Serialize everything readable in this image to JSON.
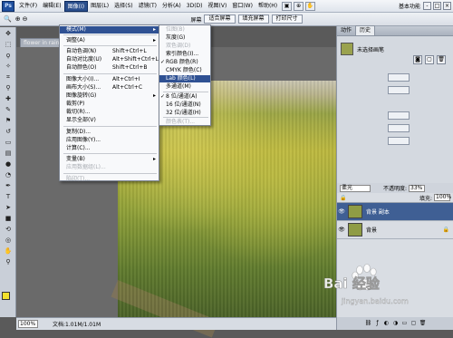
{
  "menubar": {
    "logo": "Ps",
    "items": [
      "文件(F)",
      "编辑(E)",
      "图像(I)",
      "图层(L)",
      "选择(S)",
      "滤镜(T)",
      "分析(A)",
      "3D(D)",
      "视图(V)",
      "窗口(W)",
      "帮助(H)"
    ],
    "workspace": "基本功能",
    "window_controls": [
      "-",
      "□",
      "×"
    ]
  },
  "options_bar": {
    "buttons": [
      "适合屏幕",
      "填充屏幕",
      "打印尺寸"
    ],
    "partial_label": "屏幕"
  },
  "document": {
    "tab_title": "flower in rain.jp...",
    "zoom": "100%",
    "doc_info": "文档:1.01M/1.01M"
  },
  "image_menu": {
    "items": [
      {
        "label": "模式(M)",
        "shortcut": "",
        "submenu": true,
        "highlighted": true,
        "disabled": false
      },
      {
        "label": "调整(A)",
        "shortcut": "",
        "submenu": true,
        "highlighted": false,
        "disabled": false
      },
      {
        "label": "自动色调(N)",
        "shortcut": "Shift+Ctrl+L",
        "submenu": false,
        "highlighted": false,
        "disabled": false
      },
      {
        "label": "自动对比度(U)",
        "shortcut": "Alt+Shift+Ctrl+L",
        "submenu": false,
        "highlighted": false,
        "disabled": false
      },
      {
        "label": "自动颜色(O)",
        "shortcut": "Shift+Ctrl+B",
        "submenu": false,
        "highlighted": false,
        "disabled": false
      },
      {
        "label": "图像大小(I)...",
        "shortcut": "Alt+Ctrl+I",
        "submenu": false,
        "highlighted": false,
        "disabled": false
      },
      {
        "label": "画布大小(S)...",
        "shortcut": "Alt+Ctrl+C",
        "submenu": false,
        "highlighted": false,
        "disabled": false
      },
      {
        "label": "图像旋转(G)",
        "shortcut": "",
        "submenu": true,
        "highlighted": false,
        "disabled": false
      },
      {
        "label": "裁剪(P)",
        "shortcut": "",
        "submenu": false,
        "highlighted": false,
        "disabled": false
      },
      {
        "label": "裁切(R)...",
        "shortcut": "",
        "submenu": false,
        "highlighted": false,
        "disabled": false
      },
      {
        "label": "显示全部(V)",
        "shortcut": "",
        "submenu": false,
        "highlighted": false,
        "disabled": false
      },
      {
        "label": "复制(D)...",
        "shortcut": "",
        "submenu": false,
        "highlighted": false,
        "disabled": false
      },
      {
        "label": "应用图像(Y)...",
        "shortcut": "",
        "submenu": false,
        "highlighted": false,
        "disabled": false
      },
      {
        "label": "计算(C)...",
        "shortcut": "",
        "submenu": false,
        "highlighted": false,
        "disabled": false
      },
      {
        "label": "变量(B)",
        "shortcut": "",
        "submenu": true,
        "highlighted": false,
        "disabled": false
      },
      {
        "label": "应用数据组(L)...",
        "shortcut": "",
        "submenu": false,
        "highlighted": false,
        "disabled": true
      },
      {
        "label": "陷印(T)...",
        "shortcut": "",
        "submenu": false,
        "highlighted": false,
        "disabled": true
      }
    ]
  },
  "mode_menu": {
    "items": [
      {
        "label": "位图(B)",
        "checked": false,
        "highlighted": false,
        "disabled": true
      },
      {
        "label": "灰度(G)",
        "checked": false,
        "highlighted": false,
        "disabled": false
      },
      {
        "label": "双色调(D)",
        "checked": false,
        "highlighted": false,
        "disabled": true
      },
      {
        "label": "索引颜色(I)...",
        "checked": false,
        "highlighted": false,
        "disabled": false
      },
      {
        "label": "RGB 颜色(R)",
        "checked": true,
        "highlighted": false,
        "disabled": false
      },
      {
        "label": "CMYK 颜色(C)",
        "checked": false,
        "highlighted": false,
        "disabled": false
      },
      {
        "label": "Lab 颜色(L)",
        "checked": false,
        "highlighted": true,
        "disabled": false
      },
      {
        "label": "多通道(M)",
        "checked": false,
        "highlighted": false,
        "disabled": false
      },
      {
        "label": "8 位/通道(A)",
        "checked": true,
        "highlighted": false,
        "disabled": false
      },
      {
        "label": "16 位/通道(N)",
        "checked": false,
        "highlighted": false,
        "disabled": false
      },
      {
        "label": "32 位/通道(H)",
        "checked": false,
        "highlighted": false,
        "disabled": false
      },
      {
        "label": "颜色表(T)...",
        "checked": false,
        "highlighted": false,
        "disabled": true
      }
    ]
  },
  "history_panel": {
    "tabs": [
      "动作",
      "历史"
    ],
    "snapshot_label": "未选择画笔"
  },
  "layers_panel": {
    "blend_mode": "柔光",
    "opacity_label": "不透明度:",
    "opacity": "33%",
    "fill_label": "填充:",
    "fill": "100%",
    "layers": [
      {
        "name": "背景 副本",
        "selected": true
      },
      {
        "name": "背景",
        "selected": false
      }
    ]
  },
  "colors": {
    "foreground": "#f2e12c",
    "background": "#ffffff",
    "menu_highlight": "#2f5193"
  },
  "watermark": {
    "text": "Bai 经验",
    "subtext": "jingyan.baidu.com"
  }
}
